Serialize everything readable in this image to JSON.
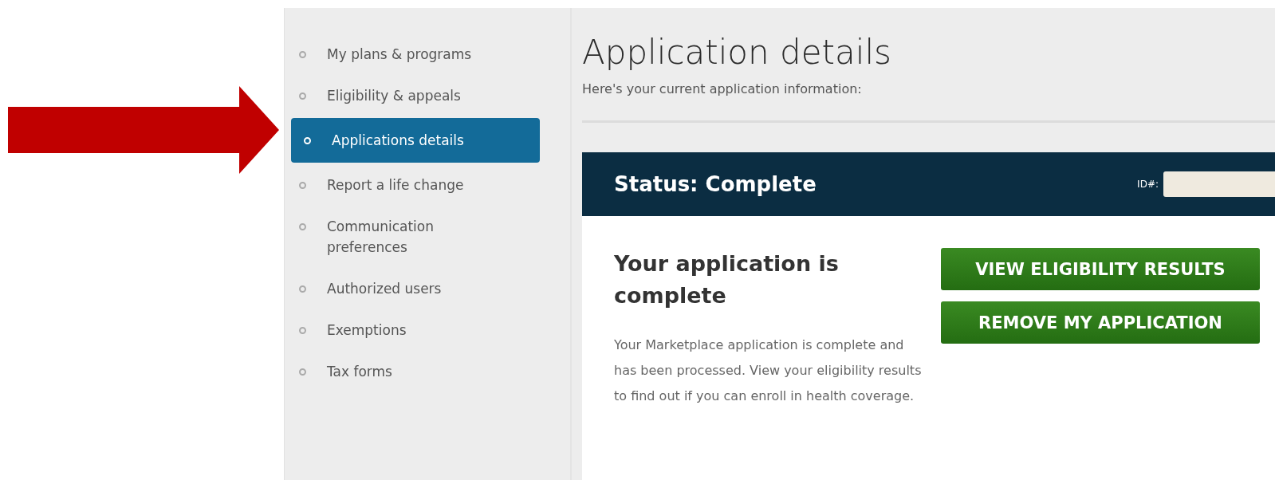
{
  "sidebar": {
    "items": [
      {
        "label": "My plans & programs",
        "selected": false
      },
      {
        "label": "Eligibility & appeals",
        "selected": false
      },
      {
        "label": "Applications details",
        "selected": true
      },
      {
        "label": "Report a life change",
        "selected": false
      },
      {
        "label": "Communication preferences",
        "selected": false
      },
      {
        "label": "Authorized users",
        "selected": false
      },
      {
        "label": "Exemptions",
        "selected": false
      },
      {
        "label": "Tax forms",
        "selected": false
      }
    ]
  },
  "main": {
    "title": "Application details",
    "subtitle": "Here's your current application information:",
    "card": {
      "status": "Status: Complete",
      "id_label": "ID#:",
      "heading": "Your application is complete",
      "text": "Your Marketplace application is complete and has been processed. View your eligibility results to find out if you can enroll in health coverage.",
      "buttons": [
        "VIEW ELIGIBILITY RESULTS",
        "REMOVE MY APPLICATION"
      ]
    }
  }
}
